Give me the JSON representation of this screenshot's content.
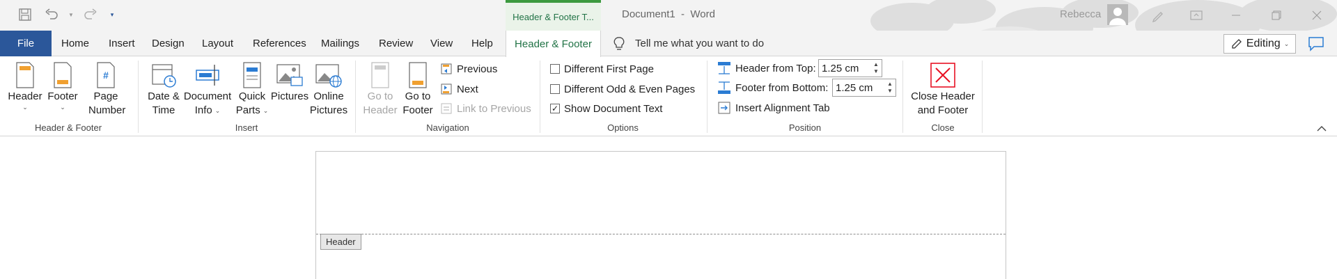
{
  "titlebar": {
    "contextual_tab": "Header & Footer T...",
    "document_title": "Document1  -  Word",
    "user_name": "Rebecca"
  },
  "tabs": {
    "file": "File",
    "items": [
      "Home",
      "Insert",
      "Design",
      "Layout",
      "References",
      "Mailings",
      "Review",
      "View",
      "Help"
    ],
    "active": "Header & Footer",
    "tell_me": "Tell me what you want to do",
    "editing": "Editing"
  },
  "ribbon": {
    "header_footer_group": {
      "label": "Header & Footer",
      "header": "Header",
      "footer": "Footer",
      "page_number": "Page Number"
    },
    "insert_group": {
      "label": "Insert",
      "date_time_1": "Date &",
      "date_time_2": "Time",
      "doc_info_1": "Document",
      "doc_info_2": "Info",
      "quick_parts_1": "Quick",
      "quick_parts_2": "Parts",
      "pictures": "Pictures",
      "online_pictures_1": "Online",
      "online_pictures_2": "Pictures"
    },
    "navigation_group": {
      "label": "Navigation",
      "go_header_1": "Go to",
      "go_header_2": "Header",
      "go_footer_1": "Go to",
      "go_footer_2": "Footer",
      "previous": "Previous",
      "next": "Next",
      "link_previous": "Link to Previous"
    },
    "options_group": {
      "label": "Options",
      "different_first": "Different First Page",
      "different_odd_even": "Different Odd & Even Pages",
      "show_doc_text": "Show Document Text",
      "different_first_checked": false,
      "different_odd_even_checked": false,
      "show_doc_text_checked": true
    },
    "position_group": {
      "label": "Position",
      "header_from_top": "Header from Top:",
      "header_from_top_value": "1.25 cm",
      "footer_from_bottom": "Footer from Bottom:",
      "footer_from_bottom_value": "1.25 cm",
      "insert_alignment_tab": "Insert Alignment Tab"
    },
    "close_group": {
      "label": "Close",
      "close_1": "Close Header",
      "close_2": "and Footer"
    }
  },
  "document": {
    "header_tag": "Header"
  },
  "colors": {
    "file_tab": "#2b579a",
    "context_green": "#217346",
    "close_red": "#e81123",
    "icon_orange": "#f0a030",
    "icon_blue": "#2b7cd3"
  }
}
